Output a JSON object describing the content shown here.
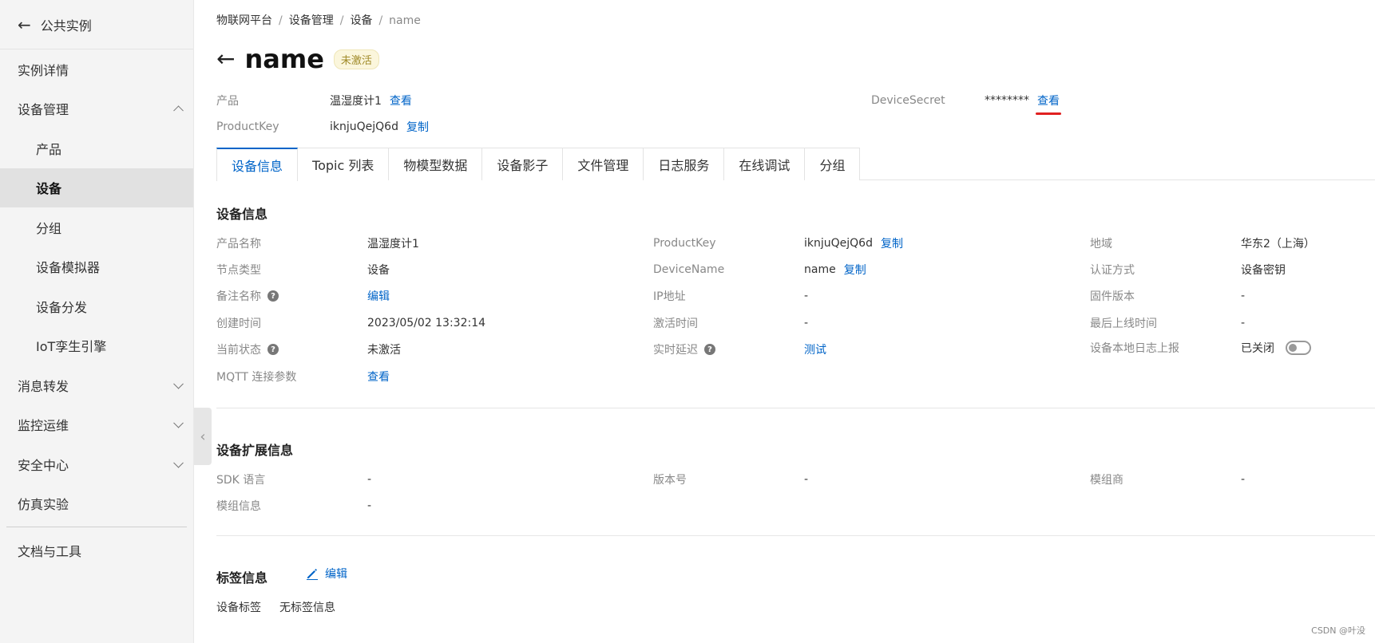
{
  "sidebar": {
    "back_label": "公共实例",
    "items": [
      {
        "label": "实例详情"
      },
      {
        "label": "设备管理"
      },
      {
        "label": "产品"
      },
      {
        "label": "设备"
      },
      {
        "label": "分组"
      },
      {
        "label": "设备模拟器"
      },
      {
        "label": "设备分发"
      },
      {
        "label": "IoT孪生引擎"
      },
      {
        "label": "消息转发"
      },
      {
        "label": "监控运维"
      },
      {
        "label": "安全中心"
      },
      {
        "label": "仿真实验"
      },
      {
        "label": "文档与工具"
      }
    ]
  },
  "breadcrumb": [
    "物联网平台",
    "设备管理",
    "设备",
    "name"
  ],
  "header": {
    "title": "name",
    "status_badge": "未激活",
    "product_label": "产品",
    "product_value": "温湿度计1",
    "product_link": "查看",
    "productkey_label": "ProductKey",
    "productkey_value": "iknjuQejQ6d",
    "productkey_copy": "复制",
    "secret_label": "DeviceSecret",
    "secret_value": "********",
    "secret_link": "查看"
  },
  "tabs": [
    "设备信息",
    "Topic 列表",
    "物模型数据",
    "设备影子",
    "文件管理",
    "日志服务",
    "在线调试",
    "分组"
  ],
  "device_info": {
    "title": "设备信息",
    "product_name_label": "产品名称",
    "product_name": "温湿度计1",
    "node_type_label": "节点类型",
    "node_type": "设备",
    "remark_label": "备注名称",
    "remark_edit": "编辑",
    "created_label": "创建时间",
    "created": "2023/05/02 13:32:14",
    "status_label": "当前状态",
    "status": "未激活",
    "mqtt_label": "MQTT 连接参数",
    "mqtt_link": "查看",
    "pk_label": "ProductKey",
    "pk": "iknjuQejQ6d",
    "pk_copy": "复制",
    "dn_label": "DeviceName",
    "dn": "name",
    "dn_copy": "复制",
    "ip_label": "IP地址",
    "ip": "-",
    "activated_label": "激活时间",
    "activated": "-",
    "latency_label": "实时延迟",
    "latency_link": "测试",
    "region_label": "地域",
    "region": "华东2（上海）",
    "auth_label": "认证方式",
    "auth": "设备密钥",
    "firmware_label": "固件版本",
    "firmware": "-",
    "last_online_label": "最后上线时间",
    "last_online": "-",
    "local_log_label": "设备本地日志上报",
    "local_log": "已关闭"
  },
  "ext_info": {
    "title": "设备扩展信息",
    "sdk_label": "SDK 语言",
    "sdk": "-",
    "module_label": "模组信息",
    "module": "-",
    "version_label": "版本号",
    "version": "-",
    "vendor_label": "模组商",
    "vendor": "-"
  },
  "tags": {
    "title": "标签信息",
    "edit": "编辑",
    "label": "设备标签",
    "value": "无标签信息"
  },
  "watermark": "CSDN @叶没",
  "accent_color": "#0064c8"
}
